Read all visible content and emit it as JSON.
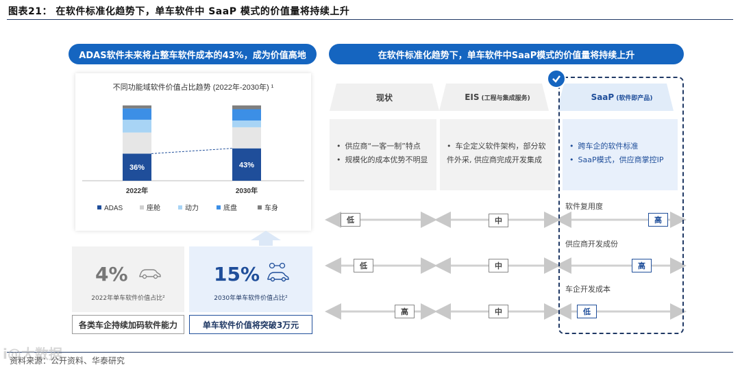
{
  "figure_title": "图表21：  在软件标准化趋势下，单车软件中 SaaP 模式的价值量将持续上升",
  "source": "资料来源：公开资料、华泰研究",
  "watermark": "i@大数据",
  "left_pill": "ADAS软件未来将占整车软件成本的43%，成为价值高地",
  "right_pill": "在软件标准化趋势下，单车软件中SaaP模式的价值量将持续上升",
  "chart_data": {
    "type": "bar",
    "title": "不同功能域软件价值占比趋势 (2022年-2030年) ¹",
    "categories": [
      "2022年",
      "2030年"
    ],
    "series": [
      {
        "name": "ADAS",
        "color": "#1f4e9a",
        "values": [
          36,
          43
        ]
      },
      {
        "name": "座舱",
        "color": "#e6e6e6",
        "values": [
          28,
          28
        ]
      },
      {
        "name": "动力",
        "color": "#a8d4f5",
        "values": [
          17,
          9
        ]
      },
      {
        "name": "底盘",
        "color": "#3c8fe6",
        "values": [
          15,
          15
        ]
      },
      {
        "name": "车身",
        "color": "#7f7f7f",
        "values": [
          4,
          5
        ]
      }
    ],
    "data_labels": [
      "36%",
      "43%"
    ],
    "stacked": true,
    "legend_position": "bottom"
  },
  "stats": {
    "a": {
      "value": "4%",
      "note": "2022年单车软件价值占比²",
      "button": "各类车企持续加码软件能力"
    },
    "b": {
      "value": "15%",
      "note": "2030年单车软件价值占比²",
      "button": "单车软件价值将突破3万元"
    }
  },
  "columns": [
    {
      "title": "现状",
      "sub": "",
      "items": [
        "供应商“一客一制”特点",
        "规模化的成本优势不明显"
      ]
    },
    {
      "title": "EIS",
      "sub": "(工程与集成服务)",
      "items": [
        "车企定义软件架构，部分软件外采, 供应商完成开发集成"
      ]
    },
    {
      "title": "SaaP",
      "sub": "(软件即产品)",
      "items": [
        "跨车企的软件标准",
        "SaaP模式，供应商掌控IP"
      ]
    }
  ],
  "metrics": [
    {
      "label": "软件复用度",
      "levels": [
        "低",
        "中",
        "高"
      ]
    },
    {
      "label": "供应商开发成份",
      "levels": [
        "低",
        "中",
        "高"
      ]
    },
    {
      "label": "车企开发成本",
      "levels": [
        "高",
        "中",
        "低"
      ]
    }
  ],
  "colors": {
    "accent": "#1565c0",
    "navy": "#1f3864"
  }
}
